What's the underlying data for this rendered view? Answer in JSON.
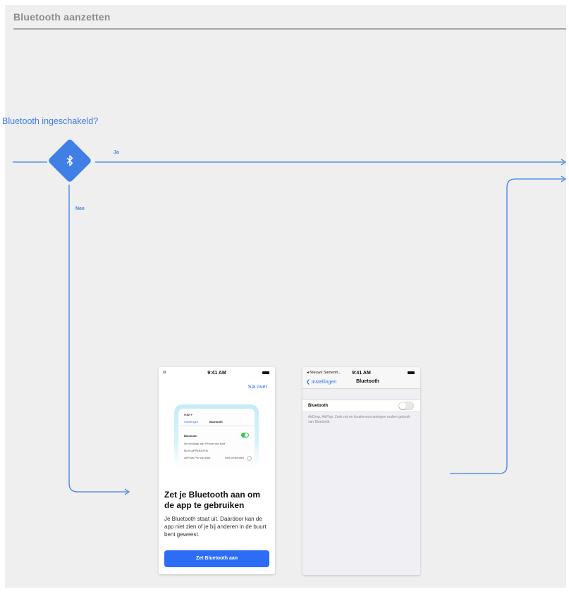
{
  "section": {
    "title": "Bluetooth aanzetten"
  },
  "decision": {
    "question": "Bluetooth ingeschakeld?",
    "icon": "bluetooth-icon",
    "yes_label": "Ja",
    "no_label": "Nee"
  },
  "colors": {
    "accent": "#3f7fe6",
    "button": "#2d6df6",
    "toggle_on": "#34c759",
    "board": "#efefef"
  },
  "screen_prompt": {
    "status": {
      "signal": "ıll",
      "time": "9:41 AM"
    },
    "skip_label": "Sla over",
    "illustration": {
      "time": "9:52 ✈",
      "nav_back": "Instellingen",
      "nav_title": "Bluetooth",
      "row_label": "Bluetooth",
      "line1": "Nu vindbaar als 'iPhone van Bart'",
      "line2": "MIJN APPARATEN",
      "line3": "AirPods Pro van Bart",
      "line3_value": "Niet verbonden"
    },
    "headline": "Zet je Bluetooth aan om de app te gebruiken",
    "body": "Je Bluetooth staat uit. Daardoor kan de app niet zien of je bij anderen in de buurt bent geweest.",
    "button_label": "Zet Bluetooth aan"
  },
  "screen_settings": {
    "status": {
      "left": "◂ Nieuws Samenh...",
      "time": "9:41 AM"
    },
    "nav_back": "Instellingen",
    "nav_title": "Bluetooth",
    "row_label": "Bluetooth",
    "toggle_on": false,
    "footnote": "AirDrop, AirPlay, Zoek mij en locatievoorzieningen maken gebruik van Bluetooth."
  }
}
